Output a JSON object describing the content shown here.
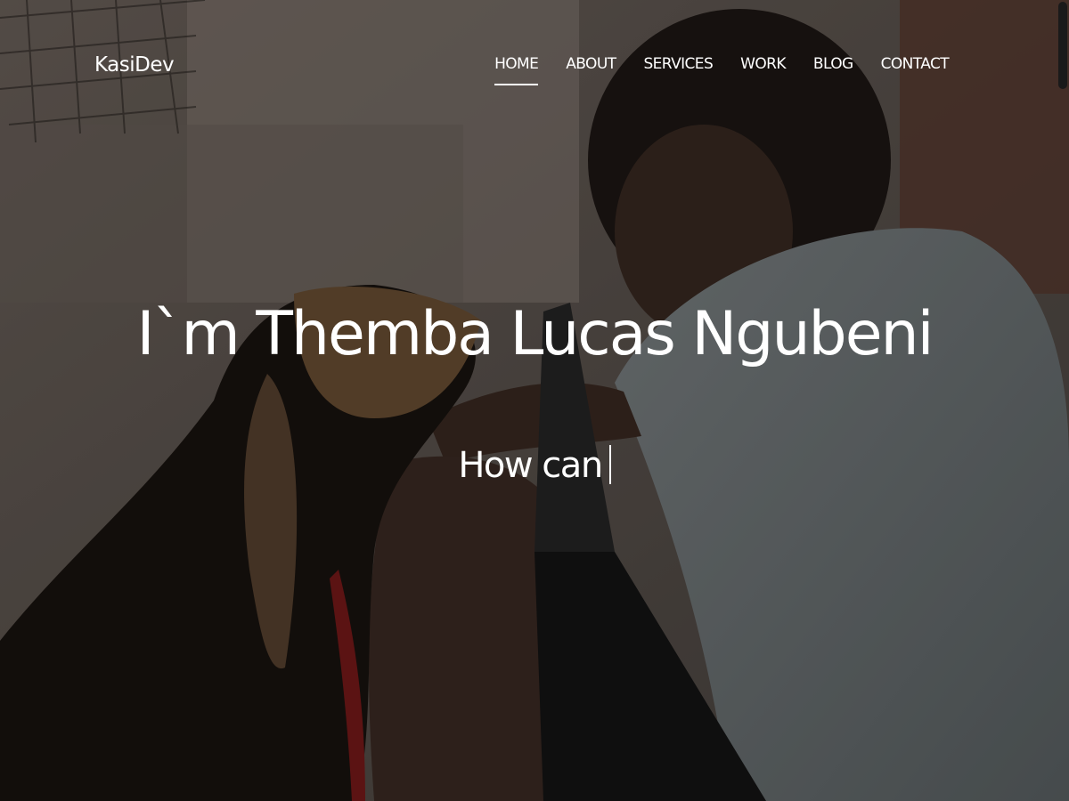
{
  "header": {
    "brand": "KasiDev",
    "nav": [
      {
        "label": "HOME",
        "active": true
      },
      {
        "label": "ABOUT",
        "active": false
      },
      {
        "label": "SERVICES",
        "active": false
      },
      {
        "label": "WORK",
        "active": false
      },
      {
        "label": "BLOG",
        "active": false
      },
      {
        "label": "CONTACT",
        "active": false
      }
    ]
  },
  "hero": {
    "title": "I`m Themba Lucas Ngubeni",
    "typed_text": "How can",
    "background": "photo-of-man-with-dog-and-laptop"
  },
  "colors": {
    "text": "#ffffff",
    "overlay": "#000000"
  }
}
